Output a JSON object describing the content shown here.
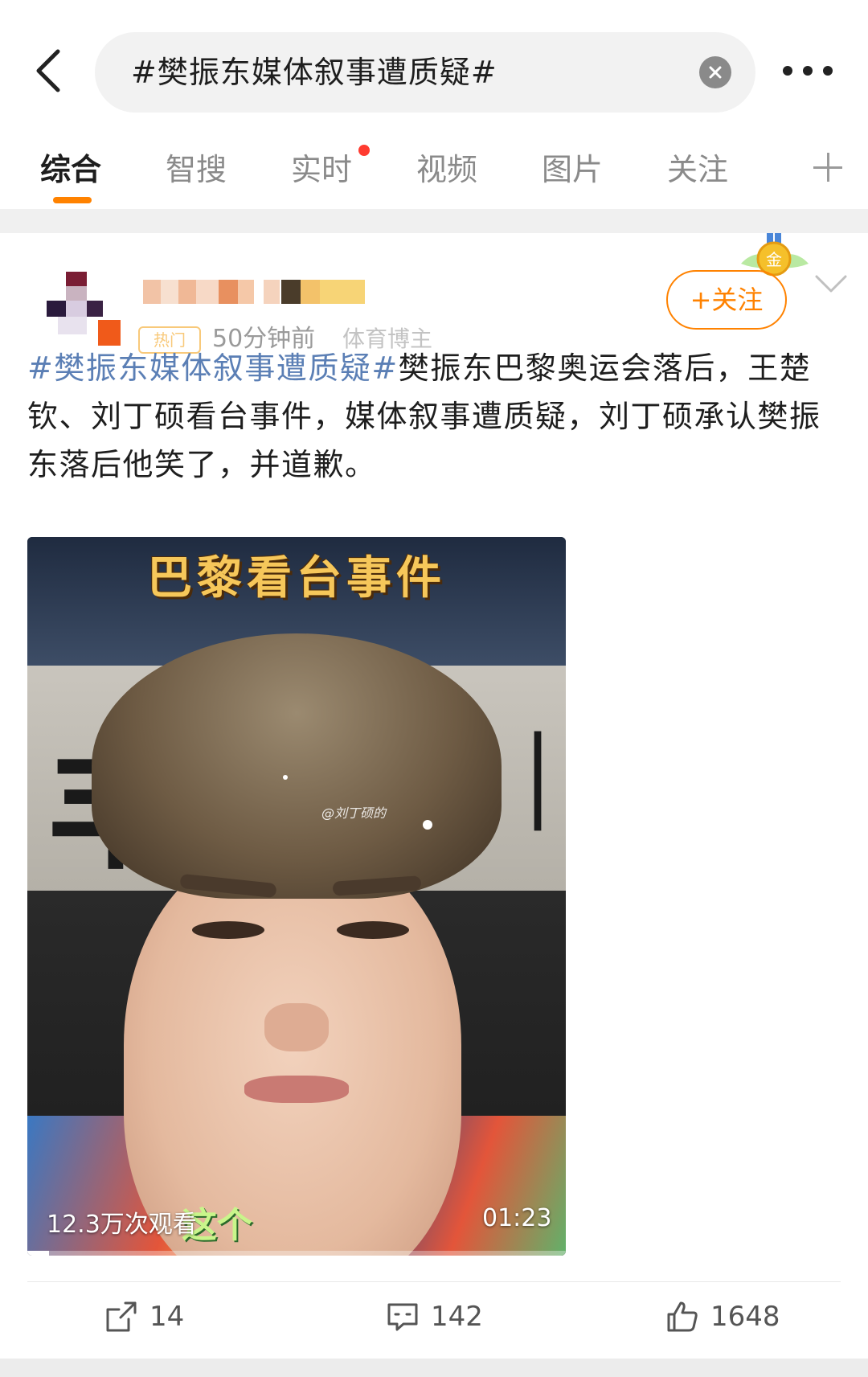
{
  "search": {
    "query": "#樊振东媒体叙事遭质疑#"
  },
  "tabs": [
    {
      "label": "综合",
      "active": true
    },
    {
      "label": "智搜",
      "active": false
    },
    {
      "label": "实时",
      "active": false,
      "has_dot": true
    },
    {
      "label": "视频",
      "active": false
    },
    {
      "label": "图片",
      "active": false
    },
    {
      "label": "关注",
      "active": false
    }
  ],
  "post": {
    "badge": "热门",
    "time": "50分钟前",
    "source": "体育博主",
    "follow_label": "+关注",
    "medal_label": "金",
    "hashtag": "#樊振东媒体叙事遭质疑#",
    "body": "樊振东巴黎奥运会落后，王楚钦、刘丁硕看台事件，媒体叙事遭质疑，刘丁硕承认樊振东落后他笑了，并道歉。",
    "video": {
      "title": "巴黎看台事件",
      "watermark": "@刘丁硕的",
      "subtitle": "这个",
      "views": "12.3万次观看",
      "duration": "01:23",
      "progress": 0.04
    }
  },
  "actions": {
    "repost_count": "14",
    "comment_count": "142",
    "like_count": "1648"
  },
  "colors": {
    "accent": "#ff8200",
    "hashtag": "#5b7fb5",
    "red_dot": "#ff3b30"
  }
}
